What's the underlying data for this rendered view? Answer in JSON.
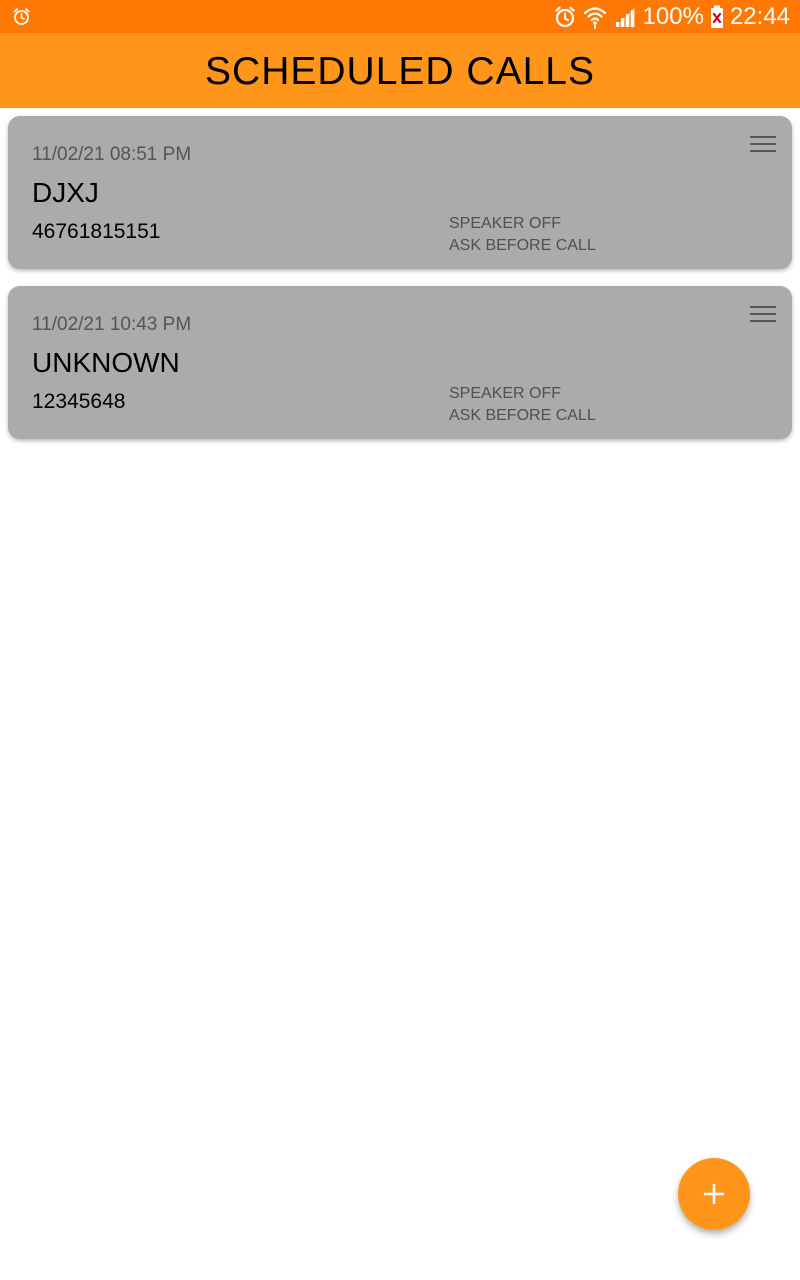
{
  "status_bar": {
    "left_icon": "alarm-icon",
    "right_icons": [
      "alarm-icon",
      "wifi-icon",
      "cell-signal-icon",
      "battery-icon"
    ],
    "battery_percent": "100%",
    "time": "22:44",
    "bar_color": "#FF7803"
  },
  "app_bar": {
    "title": "SCHEDULED CALLS",
    "color": "#FF951B"
  },
  "calls": [
    {
      "datetime": "11/02/21 08:51 PM",
      "name": "DJXJ",
      "number": "46761815151",
      "speaker": "SPEAKER OFF",
      "confirm": "ASK BEFORE CALL",
      "menu_icon": "menu-icon"
    },
    {
      "datetime": "11/02/21 10:43 PM",
      "name": "UNKNOWN",
      "number": "12345648",
      "speaker": "SPEAKER OFF",
      "confirm": "ASK BEFORE CALL",
      "menu_icon": "menu-icon"
    }
  ],
  "fab": {
    "icon": "plus-icon",
    "color": "#FF951B"
  },
  "colors": {
    "card_background": "#ABABAB",
    "secondary_text": "#555555"
  }
}
